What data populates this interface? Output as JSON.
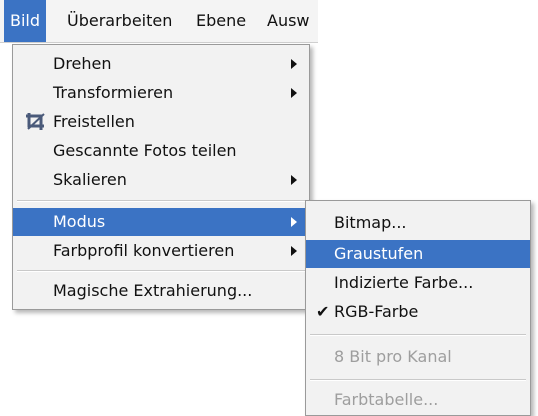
{
  "menubar": {
    "items": [
      "Bild",
      "Überarbeiten",
      "Ebene",
      "Ausw"
    ]
  },
  "bild_menu": {
    "items": [
      {
        "label": "Drehen",
        "submenu": true
      },
      {
        "label": "Transformieren",
        "submenu": true
      },
      {
        "label": "Freistellen",
        "icon": "crop-icon"
      },
      {
        "label": "Gescannte Fotos teilen"
      },
      {
        "label": "Skalieren",
        "submenu": true
      },
      {
        "label": "Modus",
        "submenu": true,
        "highlighted": true
      },
      {
        "label": "Farbprofil konvertieren",
        "submenu": true
      },
      {
        "label": "Magische Extrahierung..."
      }
    ]
  },
  "modus_menu": {
    "items": [
      {
        "label": "Bitmap..."
      },
      {
        "label": "Graustufen",
        "highlighted": true
      },
      {
        "label": "Indizierte Farbe..."
      },
      {
        "label": "RGB-Farbe",
        "checked": true
      },
      {
        "label": "8 Bit pro Kanal",
        "disabled": true
      },
      {
        "label": "Farbtabelle...",
        "disabled": true
      }
    ]
  },
  "colors": {
    "highlight": "#3b73c4",
    "menu_background": "#f2f2f2",
    "disabled_text": "#9e9e9e"
  }
}
